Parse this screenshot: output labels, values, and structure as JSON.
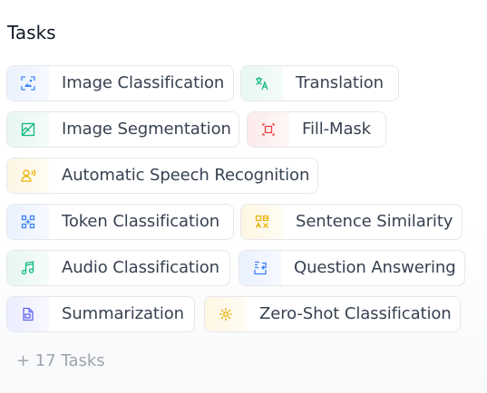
{
  "section": {
    "title": "Tasks"
  },
  "tasks": [
    {
      "label": "Image Classification",
      "icon": "image-classification-icon",
      "color": "#3b82f6"
    },
    {
      "label": "Translation",
      "icon": "translation-icon",
      "color": "#10b981"
    },
    {
      "label": "Image Segmentation",
      "icon": "image-segmentation-icon",
      "color": "#10b981"
    },
    {
      "label": "Fill-Mask",
      "icon": "fill-mask-icon",
      "color": "#ef4444"
    },
    {
      "label": "Automatic Speech Recognition",
      "icon": "speech-recognition-icon",
      "color": "#eab308"
    },
    {
      "label": "Token Classification",
      "icon": "token-classification-icon",
      "color": "#3b82f6"
    },
    {
      "label": "Sentence Similarity",
      "icon": "sentence-similarity-icon",
      "color": "#eab308"
    },
    {
      "label": "Audio Classification",
      "icon": "audio-classification-icon",
      "color": "#10b981"
    },
    {
      "label": "Question Answering",
      "icon": "question-answering-icon",
      "color": "#3b82f6"
    },
    {
      "label": "Summarization",
      "icon": "summarization-icon",
      "color": "#6366f1"
    },
    {
      "label": "Zero-Shot Classification",
      "icon": "zero-shot-classification-icon",
      "color": "#eab308"
    }
  ],
  "more_link": "+ 17 Tasks"
}
